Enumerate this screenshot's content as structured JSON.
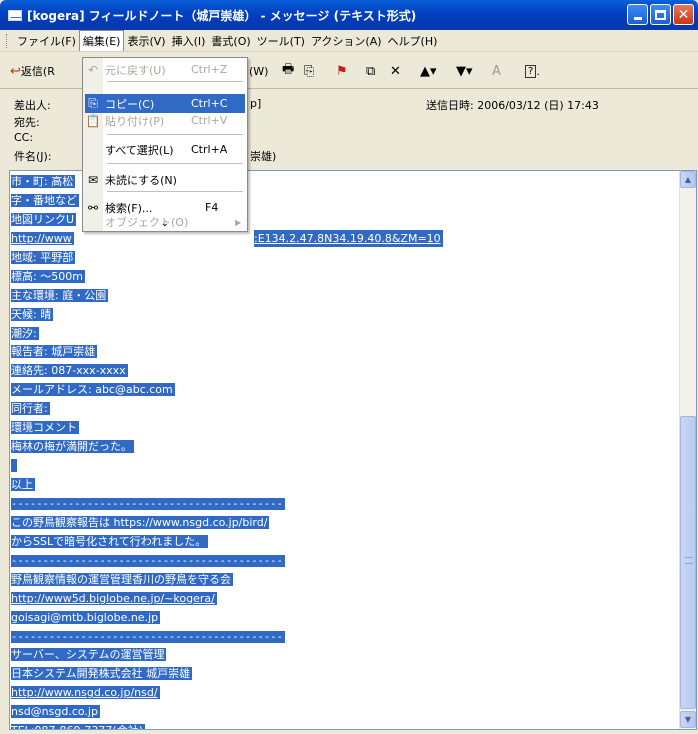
{
  "window": {
    "title": "[kogera] フィールドノート（城戸崇雄） - メッセージ (テキスト形式)",
    "minimize_label": "",
    "maximize_label": "",
    "close_label": "✕"
  },
  "menubar": [
    {
      "label": "ファイル(F)"
    },
    {
      "label": "編集(E)"
    },
    {
      "label": "表示(V)"
    },
    {
      "label": "挿入(I)"
    },
    {
      "label": "書式(O)"
    },
    {
      "label": "ツール(T)"
    },
    {
      "label": "アクション(A)"
    },
    {
      "label": "ヘルプ(H)"
    }
  ],
  "toolbar": {
    "reply_label": "返信(R",
    "partial_w": "(W)",
    "help_suffix": "."
  },
  "header": {
    "from_label": "差出人:",
    "from_value": "p]",
    "sent_label": "送信日時: 2006/03/12 (日) 17:43",
    "to_label": "宛先:",
    "cc_label": "CC:",
    "subject_label": "件名(J):",
    "subject_value": "崇雄)"
  },
  "edit_menu": {
    "undo": {
      "label": "元に戻す(U)",
      "shortcut": "Ctrl+Z"
    },
    "copy": {
      "label": "コピー(C)",
      "shortcut": "Ctrl+C"
    },
    "paste": {
      "label": "貼り付け(P)",
      "shortcut": "Ctrl+V"
    },
    "select_all": {
      "label": "すべて選択(L)",
      "shortcut": "Ctrl+A"
    },
    "mark_unread": {
      "label": "未読にする(N)"
    },
    "find": {
      "label": "検索(F)...",
      "shortcut": "F4"
    },
    "object": {
      "label": "オブジェクト(O)"
    },
    "more": "⌄"
  },
  "body_lines": [
    {
      "text": "市・町: 高松"
    },
    {
      "text": "字・番地など"
    },
    {
      "text": "地図リンクU"
    },
    {
      "text": "http://www",
      "tail": ":E134.2.47.8N34.19.40.8&ZM=10"
    },
    {
      "text": "地域: 平野部"
    },
    {
      "text": "標高: ～500m"
    },
    {
      "text": "主な環境: 庭・公園"
    },
    {
      "text": "天候: 晴"
    },
    {
      "text": "潮汐:"
    },
    {
      "text": "報告者: 城戸崇雄"
    },
    {
      "text": "連絡先: 087-xxx-xxxx"
    },
    {
      "text": "メールアドレス: abc@abc.com"
    },
    {
      "text": "同行者:"
    },
    {
      "text": "環境コメント"
    },
    {
      "text": "梅林の梅が満開だった。"
    },
    {
      "text": ""
    },
    {
      "text": "以上"
    },
    {
      "text": "-------------------------------------------"
    },
    {
      "text": "この野鳥観察報告は https://www.nsgd.co.jp/bird/"
    },
    {
      "text": "からSSLで暗号化されて行われました。"
    },
    {
      "text": "-------------------------------------------"
    },
    {
      "text": "野鳥観察情報の運営管理香川の野鳥を守る会"
    },
    {
      "text": "http://www5d.biglobe.ne.jp/~kogera/"
    },
    {
      "text": "goisagi@mtb.biglobe.ne.jp"
    },
    {
      "text": "-------------------------------------------"
    },
    {
      "text": "サーバー、システムの運営管理"
    },
    {
      "text": "日本システム開発株式会社 城戸崇雄"
    },
    {
      "text": "http://www.nsgd.co.jp/nsd/"
    },
    {
      "text": "nsd@nsgd.co.jp"
    },
    {
      "text": "TEL:087-869-7377(会社)"
    },
    {
      "text": "-------------------------------------------"
    }
  ],
  "colors": {
    "selection": "#316ac5",
    "titlebar": "#0342c4"
  }
}
